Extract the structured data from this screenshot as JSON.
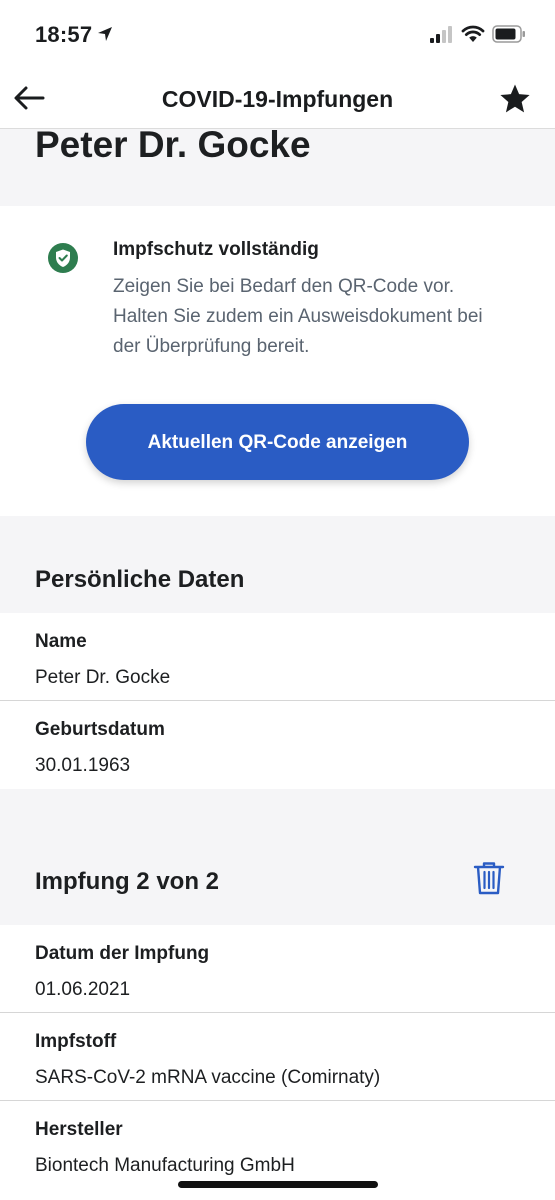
{
  "status_bar": {
    "time": "18:57"
  },
  "nav": {
    "title": "COVID-19-Impfungen"
  },
  "person_name": "Peter Dr. Gocke",
  "status_card": {
    "title": "Impfschutz vollständig",
    "description": "Zeigen Sie bei Bedarf den QR-Code vor. Halten Sie zudem ein Ausweisdokument bei der Überprüfung bereit.",
    "button_label": "Aktuellen QR-Code anzeigen"
  },
  "personal": {
    "section_title": "Persönliche Daten",
    "fields": [
      {
        "label": "Name",
        "value": "Peter Dr. Gocke"
      },
      {
        "label": "Geburtsdatum",
        "value": "30.01.1963"
      }
    ]
  },
  "vaccination": {
    "section_title": "Impfung 2 von 2",
    "fields": [
      {
        "label": "Datum der Impfung",
        "value": "01.06.2021"
      },
      {
        "label": "Impfstoff",
        "value": "SARS-CoV-2 mRNA vaccine (Comirnaty)"
      },
      {
        "label": "Hersteller",
        "value": "Biontech Manufacturing GmbH"
      }
    ]
  },
  "colors": {
    "accent": "#2a5cc4",
    "success": "#2e7d4f",
    "background": "#f5f5f7"
  },
  "icons": {
    "back": "arrow-left-icon",
    "favorite": "star-icon",
    "status": "check-shield-icon",
    "delete": "trash-icon"
  }
}
